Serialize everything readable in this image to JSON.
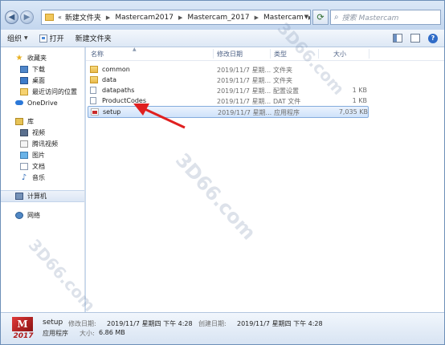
{
  "window": {
    "breadcrumb": [
      "新建文件夹",
      "Mastercam2017",
      "Mastercam_2017",
      "Mastercam"
    ],
    "search_placeholder": "搜索 Mastercam"
  },
  "toolbar": {
    "organize": "组织",
    "open": "打开",
    "new_folder": "新建文件夹"
  },
  "nav": {
    "favorites": "收藏夹",
    "fav_items": [
      "下载",
      "桌面",
      "最近访问的位置"
    ],
    "onedrive": "OneDrive",
    "libraries": "库",
    "lib_items": [
      "视频",
      "腾讯视频",
      "图片",
      "文档",
      "音乐"
    ],
    "computer": "计算机",
    "network": "网络"
  },
  "columns": {
    "name": "名称",
    "date": "修改日期",
    "type": "类型",
    "size": "大小"
  },
  "files": [
    {
      "name": "common",
      "date": "2019/11/7 星期...",
      "type": "文件夹",
      "size": "",
      "kind": "folder"
    },
    {
      "name": "data",
      "date": "2019/11/7 星期...",
      "type": "文件夹",
      "size": "",
      "kind": "folder"
    },
    {
      "name": "datapaths",
      "date": "2019/11/7 星期...",
      "type": "配置设置",
      "size": "1 KB",
      "kind": "file"
    },
    {
      "name": "ProductCodes",
      "date": "2019/11/7 星期...",
      "type": "DAT 文件",
      "size": "1 KB",
      "kind": "file"
    },
    {
      "name": "setup",
      "date": "2019/11/7 星期...",
      "type": "应用程序",
      "size": "7,035 KB",
      "kind": "exe"
    }
  ],
  "details": {
    "name": "setup",
    "kind": "应用程序",
    "modified_label": "修改日期:",
    "modified_value": "2019/11/7 星期四 下午 4:28",
    "created_label": "创建日期:",
    "created_value": "2019/11/7 星期四 下午 4:28",
    "size_label": "大小:",
    "size_value": "6.86 MB",
    "logo_year": "2017"
  },
  "watermark": "3D66.com",
  "colors": {
    "selection": "#cfe2fa",
    "arrow": "#e02020"
  }
}
